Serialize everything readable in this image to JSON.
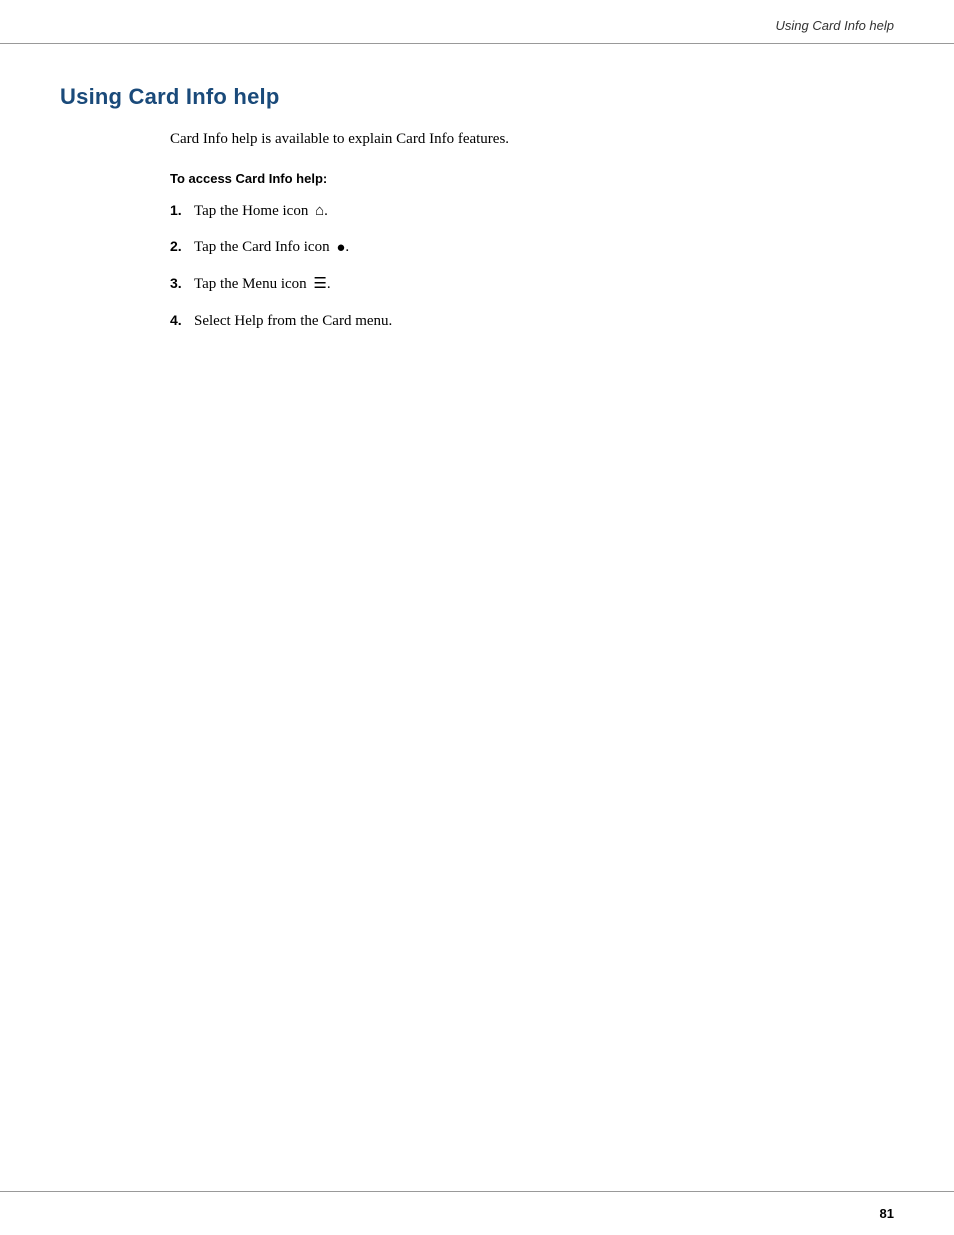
{
  "header": {
    "title": "Using Card Info help"
  },
  "page": {
    "section_title": "Using Card Info help",
    "intro": "Card Info help is available to explain Card Info features.",
    "sub_heading": "To access Card Info help:",
    "steps": [
      {
        "number": "1.",
        "text": "Tap the Home icon",
        "icon": "🏠",
        "icon_name": "home-icon"
      },
      {
        "number": "2.",
        "text": "Tap the Card Info icon",
        "icon": "🃏",
        "icon_name": "card-info-icon"
      },
      {
        "number": "3.",
        "text": "Tap the Menu icon",
        "icon": "☰",
        "icon_name": "menu-icon"
      },
      {
        "number": "4.",
        "text": "Select Help from the Card menu.",
        "icon": null,
        "icon_name": null
      }
    ]
  },
  "footer": {
    "page_number": "81"
  }
}
